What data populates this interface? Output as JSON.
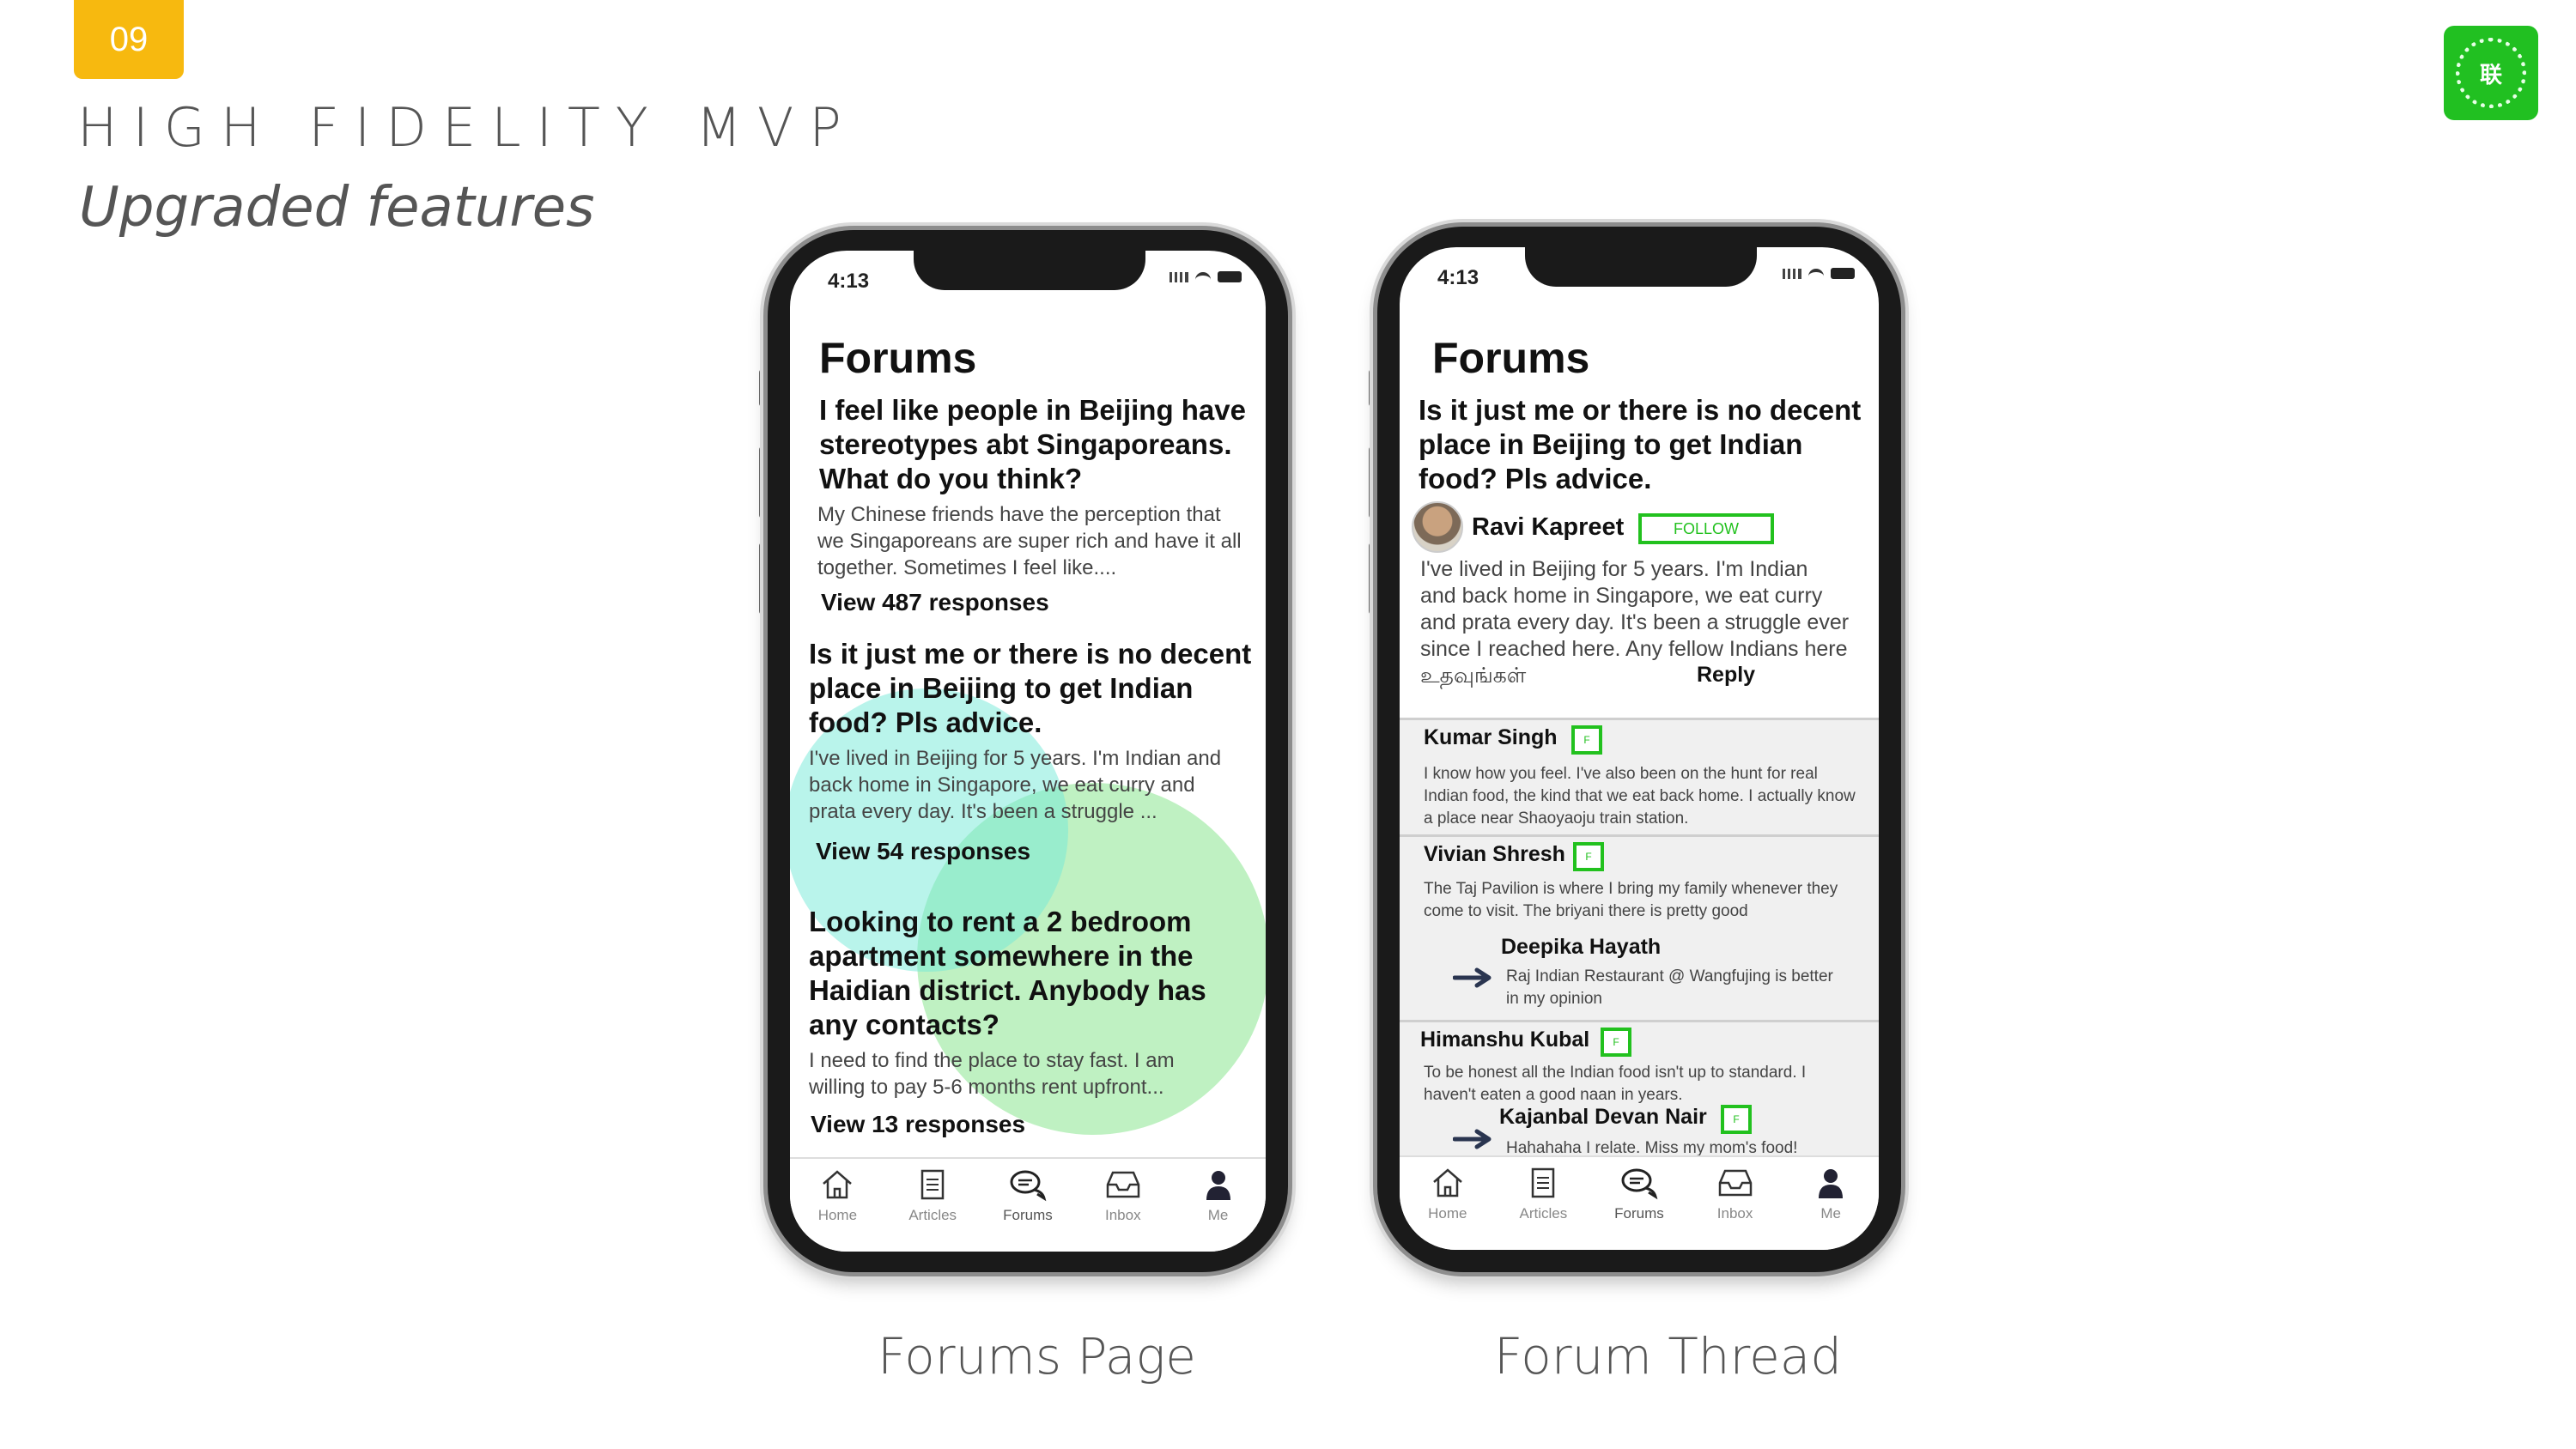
{
  "slide": {
    "number": "09",
    "title": "HIGH FIDELITY MVP",
    "subtitle": "Upgraded features",
    "logo_glyph": "联",
    "captions": {
      "left": "Forums Page",
      "right": "Forum Thread"
    }
  },
  "status_time": "4:13",
  "tabs": [
    {
      "label": "Home",
      "icon": "home-icon"
    },
    {
      "label": "Articles",
      "icon": "articles-icon"
    },
    {
      "label": "Forums",
      "icon": "forums-icon",
      "active": true
    },
    {
      "label": "Inbox",
      "icon": "inbox-icon"
    },
    {
      "label": "Me",
      "icon": "profile-icon"
    }
  ],
  "forums_page": {
    "title": "Forums",
    "posts": [
      {
        "title": "I feel like people in Beijing have stereotypes abt Singaporeans. What do you think?",
        "excerpt": "My Chinese friends have the perception that we Singaporeans are super rich and have it all together. Sometimes I feel like....",
        "responses": "View 487 responses"
      },
      {
        "title": "Is it just me or there is no decent place in Beijing to get Indian food? Pls advice.",
        "excerpt": "I've lived in Beijing for 5 years. I'm Indian and back home in Singapore, we eat curry and prata every day. It's been a struggle ...",
        "responses": "View 54 responses"
      },
      {
        "title": "Looking to rent a 2 bedroom apartment somewhere in the Haidian district. Anybody has any contacts?",
        "excerpt": "I need to find the place to stay fast. I am willing to pay 5-6 months rent upfront...",
        "responses": "View 13 responses"
      }
    ]
  },
  "thread_page": {
    "title": "Forums",
    "question": "Is it just me or there is no decent place in Beijing to get Indian food? Pls advice.",
    "author": "Ravi Kapreet",
    "follow_label": "FOLLOW",
    "body": "I've lived in Beijing for 5 years. I'm Indian and back home in Singapore, we eat curry and prata every day. It's been a struggle ever since I reached here. Any fellow Indians here உதவுங்கள்",
    "reply_label": "Reply",
    "mini_follow": "F",
    "comments": [
      {
        "name": "Kumar Singh",
        "text": "I know how you feel. I've also been on the hunt for real Indian food, the kind that we eat back home. I actually know a place near Shaoyaoju train station."
      },
      {
        "name": "Vivian Shresh",
        "text": "The Taj Pavilion is where I bring my family whenever they come to visit. The briyani there is pretty good",
        "reply": {
          "name": "Deepika Hayath",
          "text": "Raj Indian Restaurant @ Wangfujing is better in my opinion"
        }
      },
      {
        "name": "Himanshu Kubal",
        "text": "To be honest all the Indian food isn't up to standard. I haven't eaten a good naan in years.",
        "reply": {
          "name": "Kajanbal Devan Nair",
          "text": "Hahahaha I relate. Miss my mom's food!"
        }
      }
    ]
  }
}
